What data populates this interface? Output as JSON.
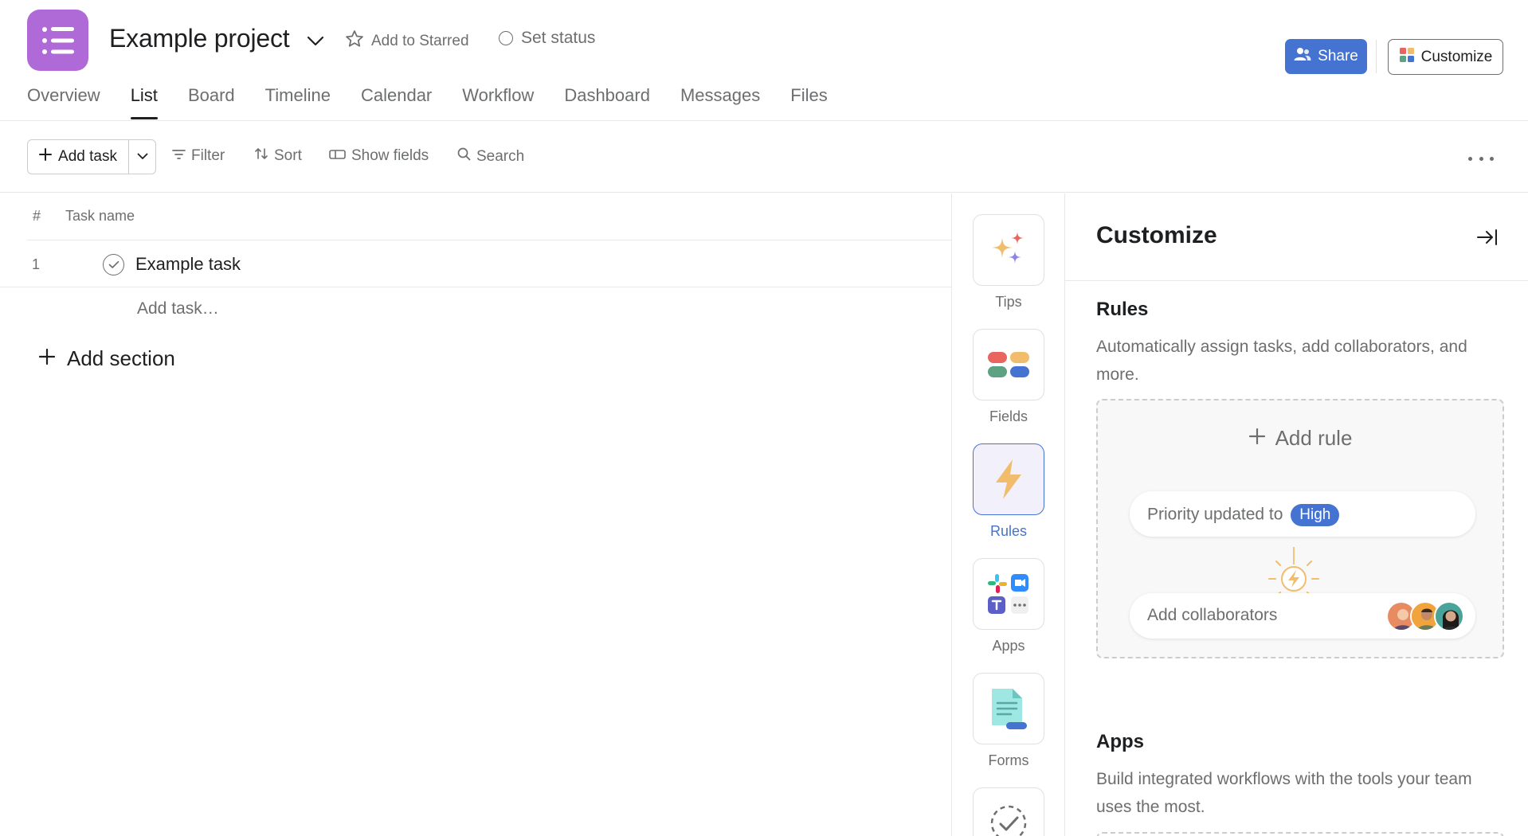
{
  "project": {
    "title": "Example project",
    "add_to_starred": "Add to Starred",
    "set_status": "Set status",
    "icon": "list-icon",
    "icon_color": "#b06ad8"
  },
  "header_actions": {
    "share_label": "Share",
    "customize_label": "Customize",
    "share_color": "#4573d2"
  },
  "tabs": [
    {
      "label": "Overview",
      "active": false
    },
    {
      "label": "List",
      "active": true
    },
    {
      "label": "Board",
      "active": false
    },
    {
      "label": "Timeline",
      "active": false
    },
    {
      "label": "Calendar",
      "active": false
    },
    {
      "label": "Workflow",
      "active": false
    },
    {
      "label": "Dashboard",
      "active": false
    },
    {
      "label": "Messages",
      "active": false
    },
    {
      "label": "Files",
      "active": false
    }
  ],
  "toolbar": {
    "add_task": "Add task",
    "filter": "Filter",
    "sort": "Sort",
    "show_fields": "Show fields",
    "search": "Search"
  },
  "table": {
    "col_number": "#",
    "col_name": "Task name",
    "rows": [
      {
        "number": "1",
        "name": "Example task"
      }
    ],
    "add_task_placeholder": "Add task…",
    "add_section": "Add section"
  },
  "rail": {
    "items": [
      {
        "label": "Tips",
        "icon": "sparkle-icon",
        "active": false
      },
      {
        "label": "Fields",
        "icon": "fields-icon",
        "active": false
      },
      {
        "label": "Rules",
        "icon": "lightning-icon",
        "active": true
      },
      {
        "label": "Apps",
        "icon": "apps-icon",
        "active": false
      },
      {
        "label": "Forms",
        "icon": "form-icon",
        "active": false
      }
    ]
  },
  "panel": {
    "title": "Customize",
    "rules": {
      "title": "Rules",
      "description": "Automatically assign tasks, add collaborators, and more.",
      "add_rule": "Add rule",
      "trigger_text": "Priority updated to",
      "trigger_value": "High",
      "action_text": "Add collaborators"
    },
    "apps": {
      "title": "Apps",
      "description": "Build integrated workflows with the tools your team uses the most."
    }
  }
}
